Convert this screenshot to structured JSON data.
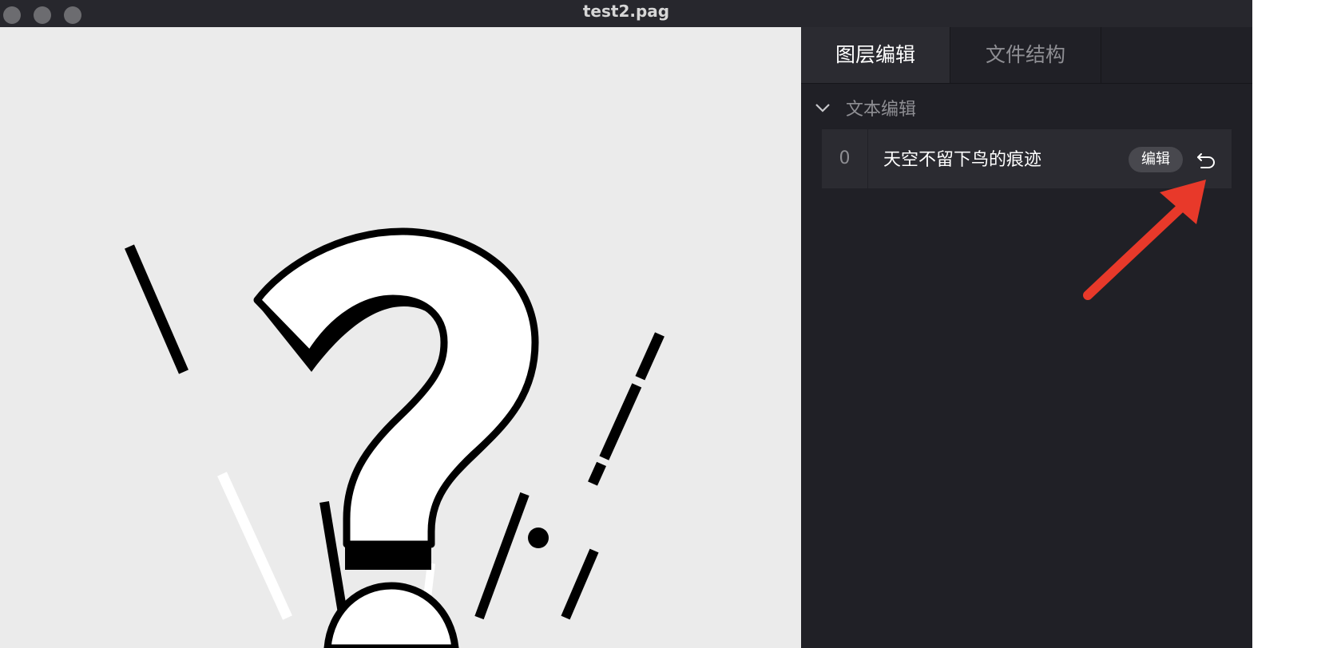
{
  "window": {
    "title": "test2.pag"
  },
  "canvas": {
    "background": "#ebebeb",
    "content": "question-mark-graphic"
  },
  "panel": {
    "tabs": [
      {
        "label": "图层编辑",
        "active": true
      },
      {
        "label": "文件结构",
        "active": false
      }
    ],
    "section": {
      "title": "文本编辑",
      "expanded": true
    },
    "text_layers": [
      {
        "index": "0",
        "text": "天空不留下鸟的痕迹",
        "edit_label": "编辑",
        "undo_icon": "undo-icon"
      }
    ]
  },
  "annotation": {
    "color": "#e8392a",
    "icon": "red-arrow-pointing-to-undo"
  }
}
